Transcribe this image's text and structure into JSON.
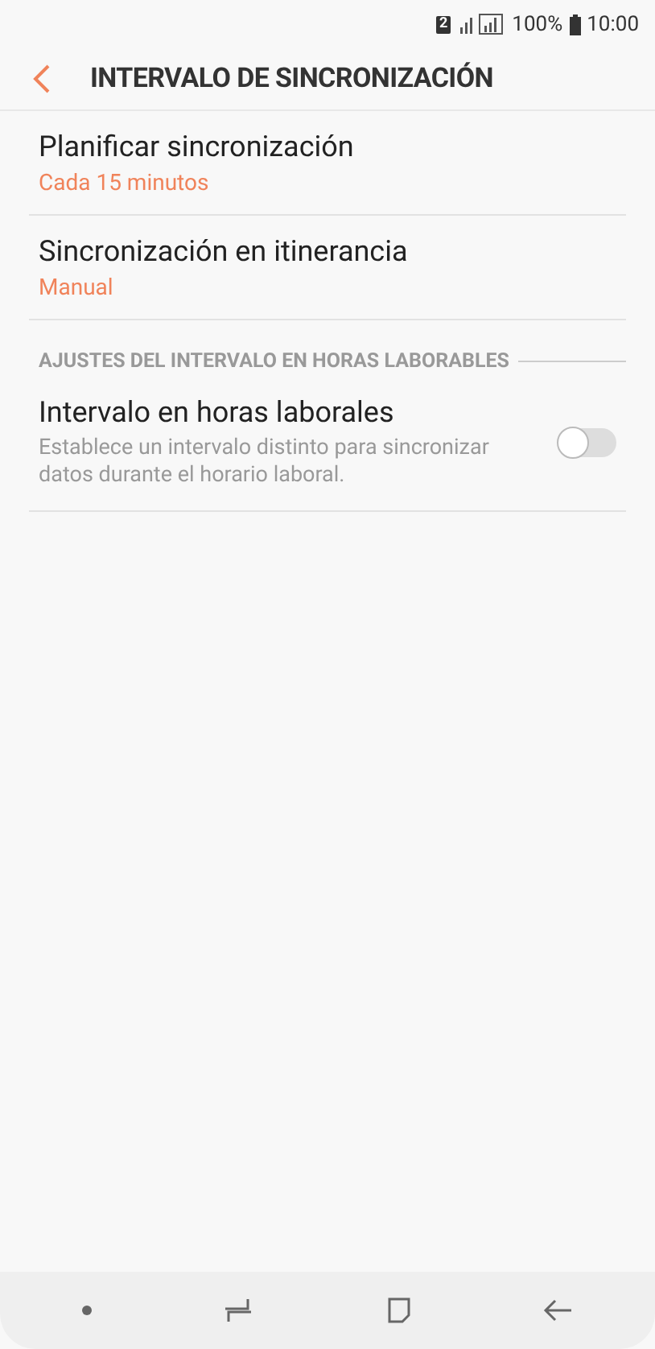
{
  "status_bar": {
    "sim": "2",
    "battery": "100%",
    "time": "10:00"
  },
  "header": {
    "title": "INTERVALO DE SINCRONIZACIÓN"
  },
  "items": [
    {
      "kind": "value",
      "title": "Planificar sincronización",
      "value": "Cada 15 minutos"
    },
    {
      "kind": "value",
      "title": "Sincronización en itinerancia",
      "value": "Manual"
    },
    {
      "kind": "section",
      "title": "AJUSTES DEL INTERVALO EN HORAS LABORABLES"
    },
    {
      "kind": "toggle",
      "title": "Intervalo en horas laborales",
      "description": "Establece un intervalo distinto para sincronizar datos durante el horario laboral.",
      "on": false
    }
  ]
}
